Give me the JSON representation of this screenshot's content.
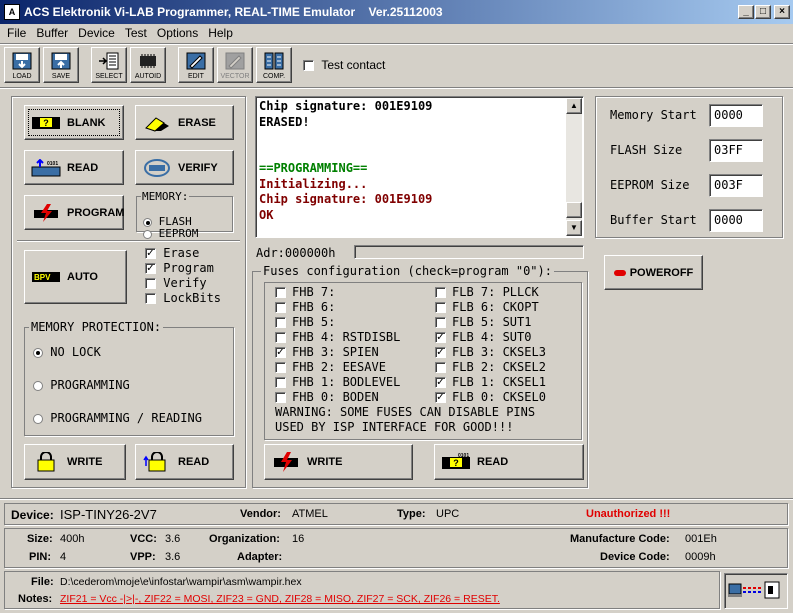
{
  "titlebar": {
    "title": "ACS Elektronik Vi-LAB Programmer, REAL-TIME Emulator    Ver.25112003",
    "icon": "chip-icon"
  },
  "menu": [
    "File",
    "Buffer",
    "Device",
    "Test",
    "Options",
    "Help"
  ],
  "toolbar": {
    "buttons": [
      {
        "label": "LOAD",
        "icon": "load-icon"
      },
      {
        "label": "SAVE",
        "icon": "save-icon"
      },
      {
        "label": "SELECT",
        "icon": "select-icon"
      },
      {
        "label": "AUTOID",
        "icon": "autoid-icon"
      },
      {
        "label": "EDIT",
        "icon": "edit-icon"
      },
      {
        "label": "VECTOR",
        "icon": "vector-icon"
      },
      {
        "label": "COMP.",
        "icon": "compare-icon"
      }
    ],
    "test_contact": "Test contact"
  },
  "ops": {
    "blank": "BLANK",
    "erase": "ERASE",
    "read": "READ",
    "verify": "VERIFY",
    "program": "PROGRAM",
    "auto": "AUTO"
  },
  "memory": {
    "title": "MEMORY:",
    "flash": "FLASH",
    "eeprom": "EEPROM"
  },
  "auto_opts": [
    {
      "label": "Erase",
      "checked": true
    },
    {
      "label": "Program",
      "checked": true
    },
    {
      "label": "Verify",
      "checked": false
    },
    {
      "label": "LockBits",
      "checked": false
    }
  ],
  "protection": {
    "title": "MEMORY PROTECTION:",
    "options": [
      {
        "label": "NO LOCK",
        "selected": true
      },
      {
        "label": "PROGRAMMING",
        "selected": false
      },
      {
        "label": "PROGRAMMING / READING",
        "selected": false
      }
    ],
    "write": "WRITE",
    "read": "READ"
  },
  "log": [
    {
      "text": "Chip signature: 001E9109",
      "color": "#000000"
    },
    {
      "text": "ERASED!",
      "color": "#000000"
    },
    {
      "text": "",
      "color": "#000000"
    },
    {
      "text": "",
      "color": "#000000"
    },
    {
      "text": "==PROGRAMMING==",
      "color": "#008000"
    },
    {
      "text": "Initializing...",
      "color": "#800000"
    },
    {
      "text": "Chip signature: 001E9109",
      "color": "#800000"
    },
    {
      "text": "OK",
      "color": "#800000"
    }
  ],
  "address": "Adr:000000h",
  "fuses": {
    "title": "Fuses configuration (check=program \"0\"):",
    "rows": [
      {
        "left": "FHB 7:",
        "left_checked": false,
        "right": "FLB 7: PLLCK",
        "right_checked": false
      },
      {
        "left": "FHB 6:",
        "left_checked": false,
        "right": "FLB 6: CKOPT",
        "right_checked": false
      },
      {
        "left": "FHB 5:",
        "left_checked": false,
        "right": "FLB 5: SUT1",
        "right_checked": false
      },
      {
        "left": "FHB 4: RSTDISBL",
        "left_checked": false,
        "right": "FLB 4: SUT0",
        "right_checked": true
      },
      {
        "left": "FHB 3: SPIEN",
        "left_checked": true,
        "right": "FLB 3: CKSEL3",
        "right_checked": true
      },
      {
        "left": "FHB 2: EESAVE",
        "left_checked": false,
        "right": "FLB 2: CKSEL2",
        "right_checked": false
      },
      {
        "left": "FHB 1: BODLEVEL",
        "left_checked": false,
        "right": "FLB 1: CKSEL1",
        "right_checked": true
      },
      {
        "left": "FHB 0: BODEN",
        "left_checked": false,
        "right": "FLB 0: CKSEL0",
        "right_checked": true
      }
    ],
    "warning1": "WARNING: SOME FUSES CAN DISABLE PINS",
    "warning2": "USED BY ISP INTERFACE FOR GOOD!!!",
    "write": "WRITE",
    "read": "READ"
  },
  "params": {
    "memory_start_label": "Memory Start",
    "memory_start": "0000",
    "flash_size_label": "FLASH Size",
    "flash_size": "03FF",
    "eeprom_size_label": "EEPROM Size",
    "eeprom_size": "003F",
    "buffer_start_label": "Buffer Start",
    "buffer_start": "0000",
    "poweroff": "POWEROFF"
  },
  "device": {
    "device_label": "Device:",
    "device": "ISP-TINY26-2V7",
    "vendor_label": "Vendor:",
    "vendor": "ATMEL",
    "type_label": "Type:",
    "type": "UPC",
    "status": "Unauthorized !!!",
    "status_color": "#e00000"
  },
  "details": {
    "size_label": "Size:",
    "size": "400h",
    "vcc_label": "VCC:",
    "vcc": "3.6",
    "org_label": "Organization:",
    "org": "16",
    "mfr_label": "Manufacture Code:",
    "mfr": "001Eh",
    "pin_label": "PIN:",
    "pin": "4",
    "vpp_label": "VPP:",
    "vpp": "3.6",
    "adapter_label": "Adapter:",
    "adapter": "",
    "devcode_label": "Device Code:",
    "devcode": "0009h"
  },
  "footer": {
    "file_label": "File:",
    "file": "D:\\cederom\\moje\\e\\infostar\\wampir\\asm\\wampir.hex",
    "notes_label": "Notes:",
    "notes": "ZIF21 = Vcc -|>|-, ZIF22 = MOSI, ZIF23 = GND, ZIF28 = MISO, ZIF27 = SCK, ZIF26 = RESET.",
    "notes_color": "#e00000"
  }
}
